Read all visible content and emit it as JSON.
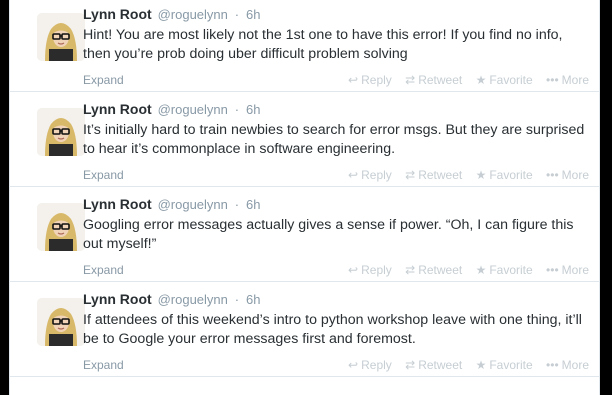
{
  "tweets": [
    {
      "fullname": "Lynn Root",
      "username": "@roguelynn",
      "separator": "·",
      "time": "6h",
      "text": "Hint! You are most likely not the 1st one to have this error! If you find no info, then you’re prob doing uber difficult problem solving",
      "expand": "Expand",
      "reply": "Reply",
      "retweet": "Retweet",
      "favorite": "Favorite",
      "more": "More"
    },
    {
      "fullname": "Lynn Root",
      "username": "@roguelynn",
      "separator": "·",
      "time": "6h",
      "text": "It’s initially hard to train newbies to search for error msgs. But they are surprised to hear it’s commonplace in software engineering.",
      "expand": "Expand",
      "reply": "Reply",
      "retweet": "Retweet",
      "favorite": "Favorite",
      "more": "More"
    },
    {
      "fullname": "Lynn Root",
      "username": "@roguelynn",
      "separator": "·",
      "time": "6h",
      "text": "Googling error messages actually gives a sense if power. “Oh, I can figure this out myself!”",
      "expand": "Expand",
      "reply": "Reply",
      "retweet": "Retweet",
      "favorite": "Favorite",
      "more": "More"
    },
    {
      "fullname": "Lynn Root",
      "username": "@roguelynn",
      "separator": "·",
      "time": "6h",
      "text": "If attendees of this weekend’s intro to python workshop leave with one thing, it’ll be to Google your error messages first and foremost.",
      "expand": "Expand",
      "reply": "Reply",
      "retweet": "Retweet",
      "favorite": "Favorite",
      "more": "More"
    }
  ],
  "icons": {
    "reply": "reply-icon",
    "retweet": "retweet-icon",
    "favorite": "star-icon",
    "more": "ellipsis-icon"
  },
  "colors": {
    "text": "#292f33",
    "meta": "#8899a6",
    "action": "#c6ced3",
    "divider": "#e1e8ed"
  }
}
